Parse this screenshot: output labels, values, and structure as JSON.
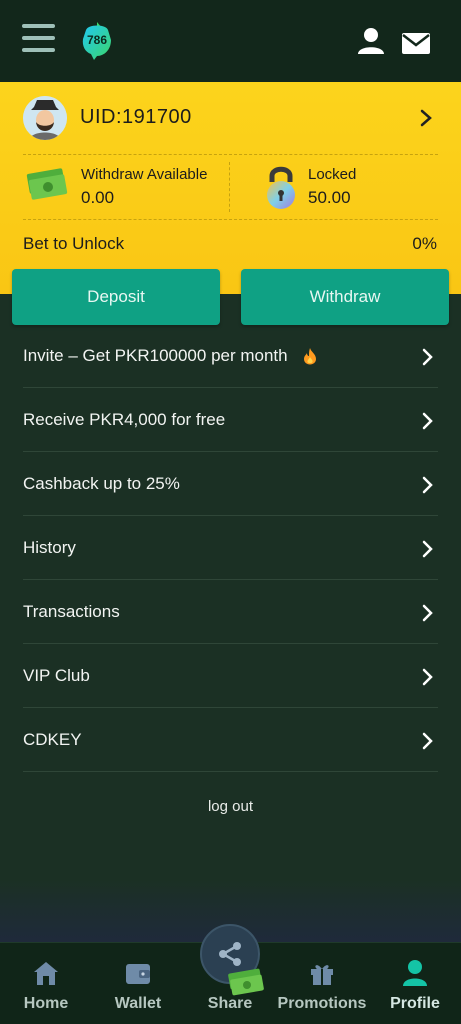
{
  "header": {
    "logo_text": "786",
    "icons": [
      "menu-icon",
      "user-icon",
      "mail-icon"
    ]
  },
  "account": {
    "uid": "UID:191700",
    "withdraw_available_label": "Withdraw Available",
    "withdraw_available_value": "0.00",
    "locked_label": "Locked",
    "locked_value": "50.00",
    "bet_to_unlock_label": "Bet to Unlock",
    "bet_to_unlock_value": "0%"
  },
  "actions": {
    "deposit_label": "Deposit",
    "withdraw_label": "Withdraw"
  },
  "menu": {
    "items": [
      {
        "label": "Invite – Get PKR100000 per month"
      },
      {
        "label": "Receive PKR4,000 for free"
      },
      {
        "label": "Cashback up to 25%"
      },
      {
        "label": "History"
      },
      {
        "label": "Transactions"
      },
      {
        "label": "VIP Club"
      },
      {
        "label": "CDKEY"
      }
    ]
  },
  "logout_label": "log out",
  "bottom_nav": {
    "items": [
      {
        "label": "Home",
        "icon": "home-icon"
      },
      {
        "label": "Wallet",
        "icon": "wallet-icon"
      },
      {
        "label": "Share",
        "icon": "share-icon"
      },
      {
        "label": "Promotions",
        "icon": "gift-icon"
      },
      {
        "label": "Profile",
        "icon": "profile-icon"
      }
    ]
  },
  "colors": {
    "header_bg": "#12271b",
    "body_bg": "#1b3024",
    "card_yellow": "#fcd41c",
    "button_green": "#0fa184",
    "active_nav": "#14c4a6"
  }
}
